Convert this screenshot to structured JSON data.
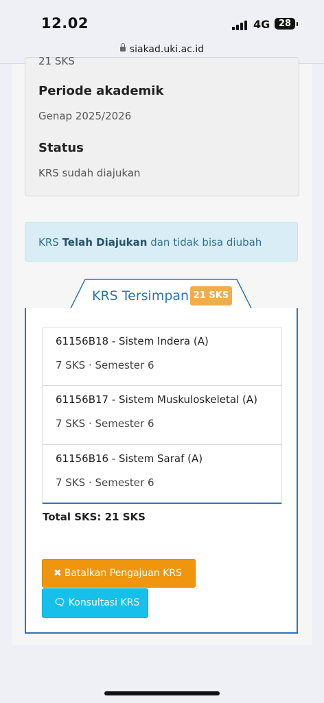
{
  "status_bar": {
    "time": "12.02",
    "network": "4G",
    "battery": "28"
  },
  "browser": {
    "url": "siakad.uki.ac.id"
  },
  "info": {
    "sks_value": "21 SKS",
    "periode_label": "Periode akademik",
    "periode_value": "Genap 2025/2026",
    "status_label": "Status",
    "status_value": "KRS sudah diajukan"
  },
  "alert": {
    "prefix": "KRS ",
    "bold": "Telah Diajukan",
    "suffix": " dan tidak bisa diubah"
  },
  "krs": {
    "title": "KRS Tersimpan",
    "badge": "21 SKS",
    "courses": [
      {
        "name": "61156B18 - Sistem Indera (A)",
        "meta": "7 SKS · Semester 6"
      },
      {
        "name": "61156B17 - Sistem Muskuloskeletal (A)",
        "meta": "7 SKS · Semester 6"
      },
      {
        "name": "61156B16 - Sistem Saraf (A)",
        "meta": "7 SKS · Semester 6"
      }
    ],
    "total": "Total SKS: 21 SKS"
  },
  "buttons": {
    "cancel_icon": "✖",
    "cancel_label": "Batalkan Pengajuan KRS",
    "consult_icon": "🗨",
    "consult_label": "Konsultasi KRS"
  },
  "colors": {
    "primary": "#2d74b5",
    "warning": "#f0950e",
    "info": "#16c0ea",
    "alert_bg": "#d9edf7"
  }
}
